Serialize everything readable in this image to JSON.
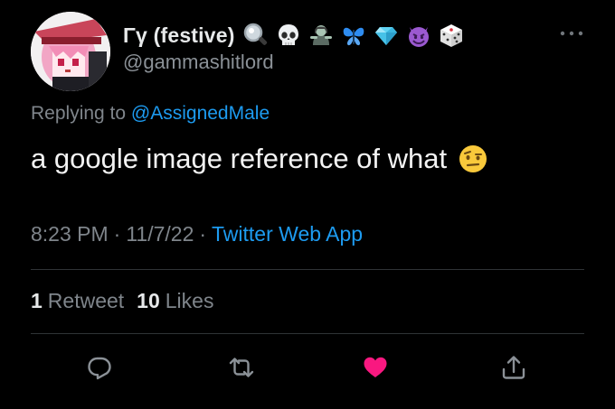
{
  "tweet": {
    "display_name": "Γγ (festive)",
    "handle": "@gammashitlord",
    "name_emojis": [
      "magnifying-glass",
      "skull",
      "woman-zombie",
      "butterfly",
      "gem",
      "smiling-imp",
      "die"
    ],
    "replying_prefix": "Replying to",
    "replying_to": "@AssignedMale",
    "text": "a google image reference of what",
    "text_emoji": "face-with-raised-eyebrow",
    "time": "8:23 PM",
    "date": "11/7/22",
    "separator": "·",
    "source": "Twitter Web App",
    "retweet_count": "1",
    "retweet_label": "Retweet",
    "like_count": "10",
    "like_label": "Likes"
  },
  "icons": {
    "more": "more-horizontal-icon",
    "reply": "reply-icon",
    "retweet": "retweet-icon",
    "like": "heart-icon",
    "share": "share-icon"
  },
  "colors": {
    "background": "#000000",
    "accent": "#1d9bf0",
    "like": "#f91880",
    "muted": "#7f858b",
    "divider": "#2f3336"
  }
}
